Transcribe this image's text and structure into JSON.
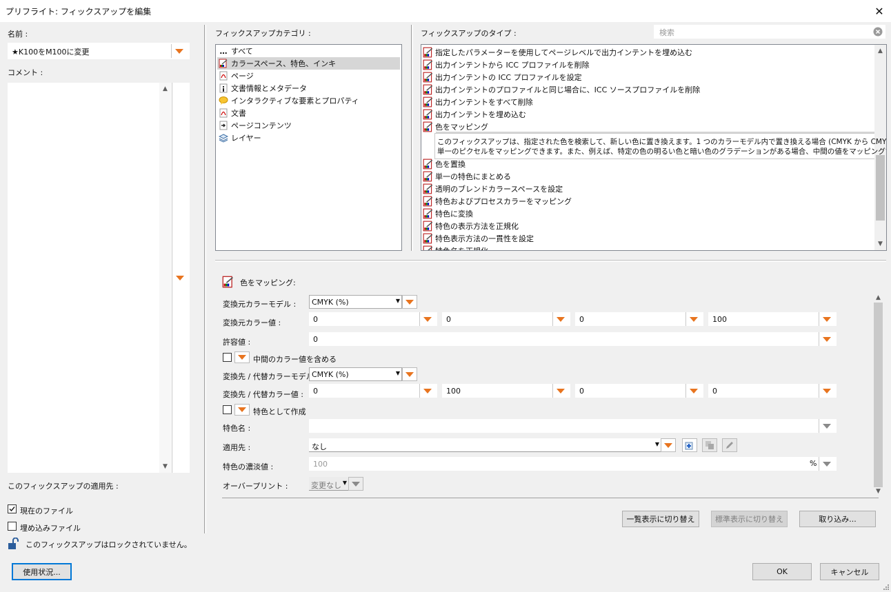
{
  "window": {
    "title": "プリフライト: フィックスアップを編集"
  },
  "left": {
    "name_label": "名前 :",
    "name_value": "★K100をM100に変更",
    "comment_label": "コメント :",
    "applies_to_label": "このフィックスアップの適用先 :",
    "current_file_label": "現在のファイル",
    "embedded_file_label": "埋め込みファイル",
    "lock_text": "このフィックスアップはロックされていません。",
    "usage_button": "使用状況..."
  },
  "categories": {
    "label": "フィックスアップカテゴリ :",
    "items": [
      {
        "label": "すべて",
        "icon": "dots-icon"
      },
      {
        "label": "カラースペース、特色、インキ",
        "icon": "color-fixup-icon"
      },
      {
        "label": "ページ",
        "icon": "pdf-icon"
      },
      {
        "label": "文書情報とメタデータ",
        "icon": "info-icon"
      },
      {
        "label": "インタラクティブな要素とプロパティ",
        "icon": "comment-icon"
      },
      {
        "label": "文書",
        "icon": "pdf-icon"
      },
      {
        "label": "ページコンテンツ",
        "icon": "arrow-icon"
      },
      {
        "label": "レイヤー",
        "icon": "layers-icon"
      }
    ]
  },
  "types": {
    "label": "フィックスアップのタイプ :",
    "search_placeholder": "検索",
    "items": [
      "指定したパラメーターを使用してページレベルで出力インテントを埋め込む",
      "出力インテントから ICC プロファイルを削除",
      "出力インテントの ICC プロファイルを設定",
      "出力インテントのプロファイルと同じ場合に、ICC ソースプロファイルを削除",
      "出力インテントをすべて削除",
      "出力インテントを埋め込む",
      "色をマッピング",
      "色を置換",
      "単一の特色にまとめる",
      "透明のブレンドカラースペースを設定",
      "特色およびプロセスカラーをマッピング",
      "特色に変換",
      "特色の表示方法を正規化",
      "特色表示方法の一貫性を設定",
      "特色名を正規化"
    ],
    "description_line1": "このフィックスアップは、指定された色を検索して、新しい色に置き換えます。1 つのカラーモデル内で置き換える場合 (CMYK から CMYK など)、画像の",
    "description_line2": "単一のピクセルをマッピングできます。また、例えば、特定の色の明るい色と暗い色のグラデーションがある場合、中間の値をマッピングできます。"
  },
  "settings": {
    "header": "色をマッピング:",
    "source_model_label": "変換元カラーモデル :",
    "source_model_value": "CMYK (%)",
    "source_values_label": "変換元カラー値 :",
    "source_values": [
      "0",
      "0",
      "0",
      "100"
    ],
    "tolerance_label": "許容値 :",
    "tolerance_value": "0",
    "include_intermediate_label": "中間のカラー値を含める",
    "dest_model_label": "変換先 / 代替カラーモデル :",
    "dest_model_value": "CMYK (%)",
    "dest_values_label": "変換先 / 代替カラー値 :",
    "dest_values": [
      "0",
      "100",
      "0",
      "0"
    ],
    "create_spot_label": "特色として作成",
    "spot_name_label": "特色名 :",
    "spot_name_value": "",
    "apply_to_label": "適用先 :",
    "apply_to_value": "なし",
    "tint_label": "特色の濃淡値 :",
    "tint_value": "100",
    "tint_unit": "%",
    "overprint_label": "オーバープリント :",
    "overprint_value": "変更なし"
  },
  "buttons": {
    "list_view": "一覧表示に切り替え",
    "standard_view": "標準表示に切り替え",
    "import": "取り込み...",
    "ok": "OK",
    "cancel": "キャンセル"
  },
  "colors": {
    "accent_orange": "#e8741f",
    "selection_gray": "#d6d6d6",
    "focus_blue": "#0078d7"
  }
}
